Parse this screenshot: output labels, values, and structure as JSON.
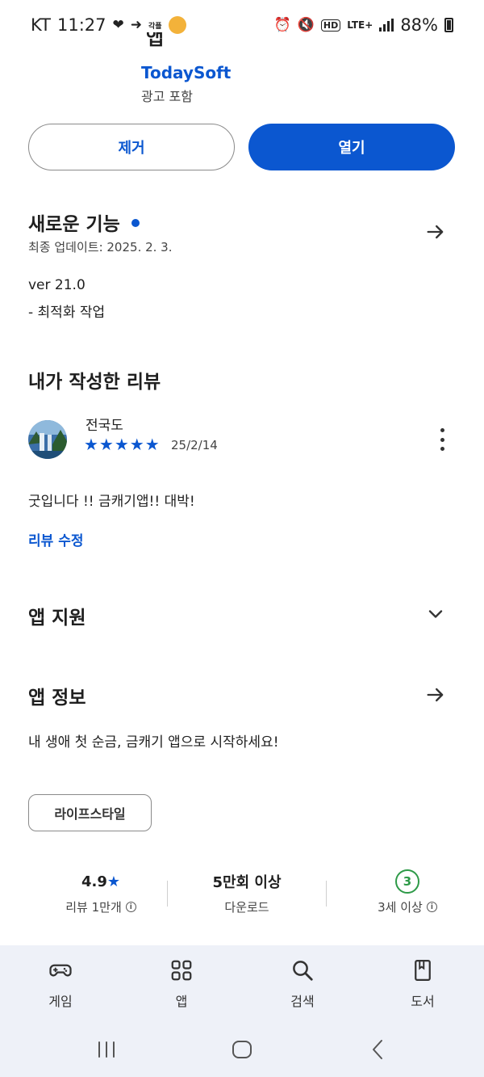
{
  "status_bar": {
    "carrier": "KT",
    "time": "11:27",
    "left_icons": [
      "heart-icon",
      "runner-icon",
      "app-badge-icon",
      "coin-icon"
    ],
    "small_badge": "각플",
    "right_icons": [
      "alarm-icon",
      "mute-icon",
      "hd-icon",
      "lte-icon",
      "signal-icon"
    ],
    "lte": "LTE+",
    "hd": "HD",
    "battery": "88%"
  },
  "app_header": {
    "partial_title": "앱",
    "developer": "TodaySoft",
    "ads_notice": "광고 포함"
  },
  "actions": {
    "remove_label": "제거",
    "open_label": "열기"
  },
  "whats_new": {
    "title": "새로운 기능",
    "updated": "최종 업데이트: 2025. 2. 3.",
    "version": "ver 21.0",
    "note": "- 최적화 작업"
  },
  "my_review": {
    "title": "내가 작성한 리뷰",
    "reviewer": "전국도",
    "rating": 5,
    "stars": "★★★★★",
    "date": "25/2/14",
    "text": "굿입니다 !! 금캐기앱!!  대박!",
    "edit_label": "리뷰 수정"
  },
  "app_support": {
    "title": "앱 지원"
  },
  "app_info": {
    "title": "앱 정보",
    "description": "내 생애 첫 순금, 금캐기 앱으로 시작하세요!",
    "category": "라이프스타일"
  },
  "stats": {
    "rating_value": "4.9",
    "rating_star": "★",
    "rating_label": "리뷰 1만개",
    "downloads_value": "5만회 이상",
    "downloads_label": "다운로드",
    "age_value": "3",
    "age_label": "3세 이상"
  },
  "bottom_nav": {
    "items": [
      {
        "label": "게임",
        "icon": "gamepad-icon"
      },
      {
        "label": "앱",
        "icon": "apps-grid-icon"
      },
      {
        "label": "검색",
        "icon": "search-icon"
      },
      {
        "label": "도서",
        "icon": "book-icon"
      }
    ]
  },
  "colors": {
    "accent": "#0b57d0",
    "age_badge": "#2e9a48",
    "nav_background": "#eef1f8"
  }
}
